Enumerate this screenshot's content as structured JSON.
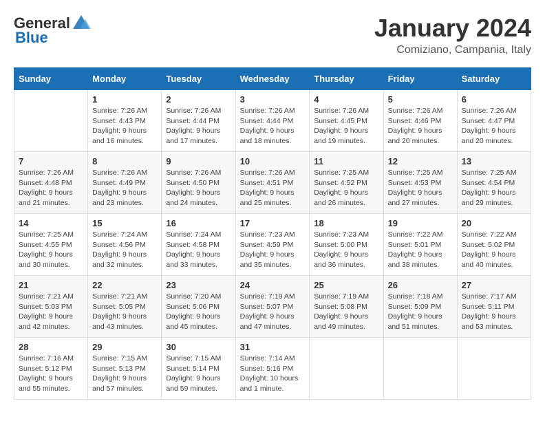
{
  "header": {
    "logo_general": "General",
    "logo_blue": "Blue",
    "month": "January 2024",
    "location": "Comiziano, Campania, Italy"
  },
  "columns": [
    "Sunday",
    "Monday",
    "Tuesday",
    "Wednesday",
    "Thursday",
    "Friday",
    "Saturday"
  ],
  "weeks": [
    [
      {
        "day": "",
        "info": ""
      },
      {
        "day": "1",
        "info": "Sunrise: 7:26 AM\nSunset: 4:43 PM\nDaylight: 9 hours\nand 16 minutes."
      },
      {
        "day": "2",
        "info": "Sunrise: 7:26 AM\nSunset: 4:44 PM\nDaylight: 9 hours\nand 17 minutes."
      },
      {
        "day": "3",
        "info": "Sunrise: 7:26 AM\nSunset: 4:44 PM\nDaylight: 9 hours\nand 18 minutes."
      },
      {
        "day": "4",
        "info": "Sunrise: 7:26 AM\nSunset: 4:45 PM\nDaylight: 9 hours\nand 19 minutes."
      },
      {
        "day": "5",
        "info": "Sunrise: 7:26 AM\nSunset: 4:46 PM\nDaylight: 9 hours\nand 20 minutes."
      },
      {
        "day": "6",
        "info": "Sunrise: 7:26 AM\nSunset: 4:47 PM\nDaylight: 9 hours\nand 20 minutes."
      }
    ],
    [
      {
        "day": "7",
        "info": "Sunrise: 7:26 AM\nSunset: 4:48 PM\nDaylight: 9 hours\nand 21 minutes."
      },
      {
        "day": "8",
        "info": "Sunrise: 7:26 AM\nSunset: 4:49 PM\nDaylight: 9 hours\nand 23 minutes."
      },
      {
        "day": "9",
        "info": "Sunrise: 7:26 AM\nSunset: 4:50 PM\nDaylight: 9 hours\nand 24 minutes."
      },
      {
        "day": "10",
        "info": "Sunrise: 7:26 AM\nSunset: 4:51 PM\nDaylight: 9 hours\nand 25 minutes."
      },
      {
        "day": "11",
        "info": "Sunrise: 7:25 AM\nSunset: 4:52 PM\nDaylight: 9 hours\nand 26 minutes."
      },
      {
        "day": "12",
        "info": "Sunrise: 7:25 AM\nSunset: 4:53 PM\nDaylight: 9 hours\nand 27 minutes."
      },
      {
        "day": "13",
        "info": "Sunrise: 7:25 AM\nSunset: 4:54 PM\nDaylight: 9 hours\nand 29 minutes."
      }
    ],
    [
      {
        "day": "14",
        "info": "Sunrise: 7:25 AM\nSunset: 4:55 PM\nDaylight: 9 hours\nand 30 minutes."
      },
      {
        "day": "15",
        "info": "Sunrise: 7:24 AM\nSunset: 4:56 PM\nDaylight: 9 hours\nand 32 minutes."
      },
      {
        "day": "16",
        "info": "Sunrise: 7:24 AM\nSunset: 4:58 PM\nDaylight: 9 hours\nand 33 minutes."
      },
      {
        "day": "17",
        "info": "Sunrise: 7:23 AM\nSunset: 4:59 PM\nDaylight: 9 hours\nand 35 minutes."
      },
      {
        "day": "18",
        "info": "Sunrise: 7:23 AM\nSunset: 5:00 PM\nDaylight: 9 hours\nand 36 minutes."
      },
      {
        "day": "19",
        "info": "Sunrise: 7:22 AM\nSunset: 5:01 PM\nDaylight: 9 hours\nand 38 minutes."
      },
      {
        "day": "20",
        "info": "Sunrise: 7:22 AM\nSunset: 5:02 PM\nDaylight: 9 hours\nand 40 minutes."
      }
    ],
    [
      {
        "day": "21",
        "info": "Sunrise: 7:21 AM\nSunset: 5:03 PM\nDaylight: 9 hours\nand 42 minutes."
      },
      {
        "day": "22",
        "info": "Sunrise: 7:21 AM\nSunset: 5:05 PM\nDaylight: 9 hours\nand 43 minutes."
      },
      {
        "day": "23",
        "info": "Sunrise: 7:20 AM\nSunset: 5:06 PM\nDaylight: 9 hours\nand 45 minutes."
      },
      {
        "day": "24",
        "info": "Sunrise: 7:19 AM\nSunset: 5:07 PM\nDaylight: 9 hours\nand 47 minutes."
      },
      {
        "day": "25",
        "info": "Sunrise: 7:19 AM\nSunset: 5:08 PM\nDaylight: 9 hours\nand 49 minutes."
      },
      {
        "day": "26",
        "info": "Sunrise: 7:18 AM\nSunset: 5:09 PM\nDaylight: 9 hours\nand 51 minutes."
      },
      {
        "day": "27",
        "info": "Sunrise: 7:17 AM\nSunset: 5:11 PM\nDaylight: 9 hours\nand 53 minutes."
      }
    ],
    [
      {
        "day": "28",
        "info": "Sunrise: 7:16 AM\nSunset: 5:12 PM\nDaylight: 9 hours\nand 55 minutes."
      },
      {
        "day": "29",
        "info": "Sunrise: 7:15 AM\nSunset: 5:13 PM\nDaylight: 9 hours\nand 57 minutes."
      },
      {
        "day": "30",
        "info": "Sunrise: 7:15 AM\nSunset: 5:14 PM\nDaylight: 9 hours\nand 59 minutes."
      },
      {
        "day": "31",
        "info": "Sunrise: 7:14 AM\nSunset: 5:16 PM\nDaylight: 10 hours\nand 1 minute."
      },
      {
        "day": "",
        "info": ""
      },
      {
        "day": "",
        "info": ""
      },
      {
        "day": "",
        "info": ""
      }
    ]
  ]
}
